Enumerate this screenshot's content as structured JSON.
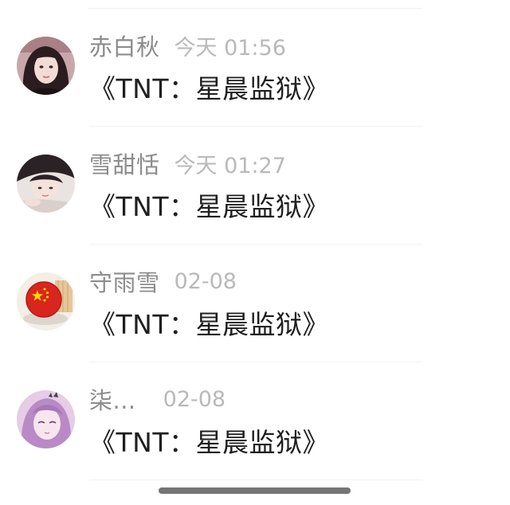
{
  "comments": [
    {
      "username": "赤白秋",
      "timestamp": "今天 01:56",
      "text": "《TNT：星晨监狱》",
      "avatar_icon": "user-avatar-photo-girl-dark-hair"
    },
    {
      "username": "雪甜恬",
      "timestamp": "今天 01:27",
      "text": "《TNT：星晨监狱》",
      "avatar_icon": "user-avatar-photo-girl-lying"
    },
    {
      "username": "守雨雪",
      "timestamp": "02-08",
      "text": "《TNT：星晨监狱》",
      "avatar_icon": "user-avatar-china-flag-badge"
    },
    {
      "username": "柒...",
      "timestamp": "02-08",
      "text": "《TNT：星晨监狱》",
      "avatar_icon": "user-avatar-anime-character"
    }
  ],
  "colors": {
    "username": "#8c8c8c",
    "timestamp": "#b9b9b9",
    "comment_text": "#1f1f1f",
    "home_indicator": "#757575"
  }
}
